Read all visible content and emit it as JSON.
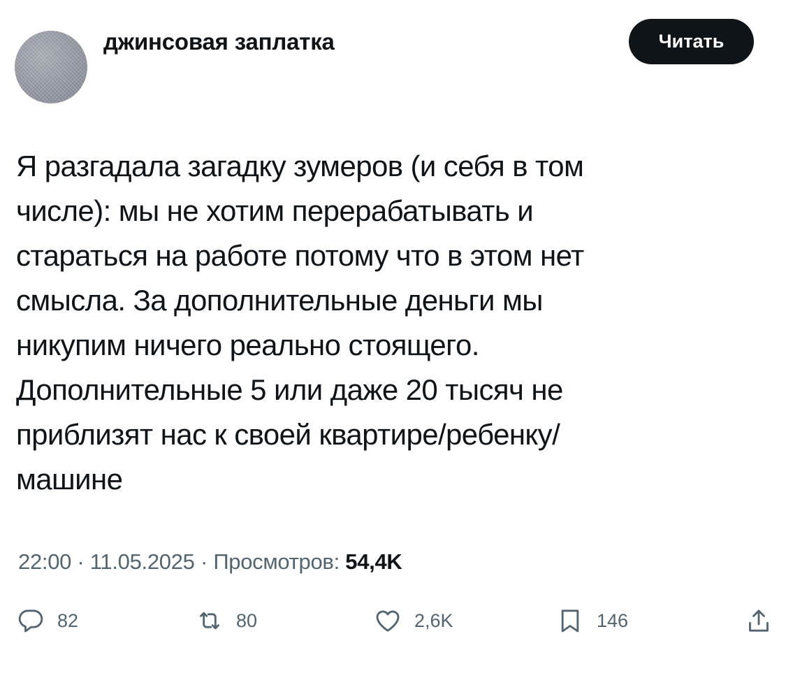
{
  "author": {
    "name": "джинсовая заплатка"
  },
  "follow_button": {
    "label": "Читать"
  },
  "tweet": {
    "lines": [
      "Я разгадала загадку зумеров (и себя в том",
      "числе): мы не хотим перерабатывать и",
      "стараться на работе потому что в этом нет",
      "смысла. За дополнительные деньги мы",
      "никупим ничего реально стоящего.",
      "Дополнительные 5 или даже 20 тысяч не",
      "приблизят нас к своей квартире/ребенку/",
      "машине"
    ]
  },
  "meta": {
    "time": "22:00",
    "separator": "·",
    "date": "11.05.2025",
    "views_label": "Просмотров:",
    "views_count": "54,4K"
  },
  "actions": {
    "replies": "82",
    "reposts": "80",
    "likes": "2,6K",
    "bookmarks": "146"
  },
  "icons": {
    "reply": "reply-icon",
    "repost": "repost-icon",
    "like": "heart-icon",
    "bookmark": "bookmark-icon",
    "share": "share-icon"
  },
  "colors": {
    "text": "#0f1419",
    "secondary": "#536471",
    "button_bg": "#0f1419",
    "button_text": "#ffffff"
  }
}
